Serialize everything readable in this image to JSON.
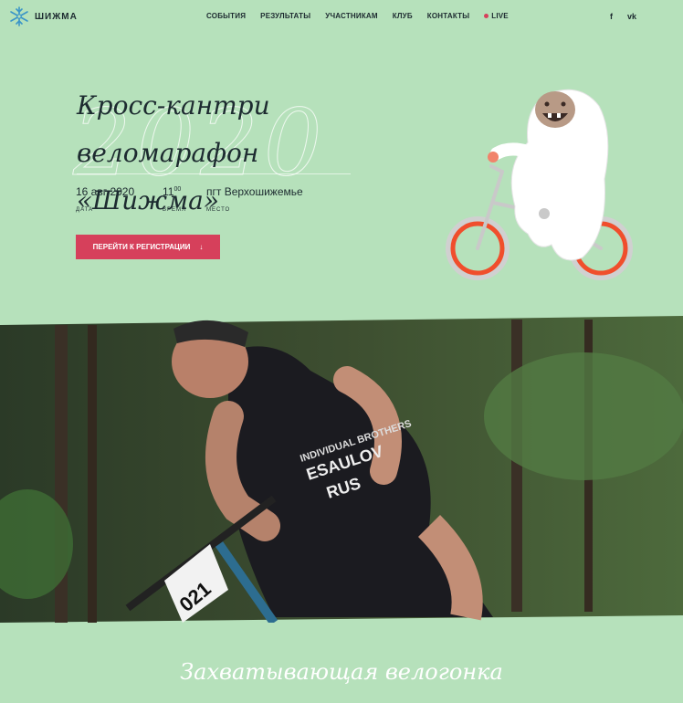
{
  "nav": {
    "logo_text": "ШИЖМА",
    "items": [
      "СОБЫТИЯ",
      "РЕЗУЛЬТАТЫ",
      "УЧАСТНИКАМ",
      "КЛУБ",
      "КОНТАКТЫ"
    ],
    "live_label": "LIVE",
    "social": {
      "facebook": "f",
      "vk": "vk"
    }
  },
  "hero": {
    "title_line1": "Кросс-кантри веломарафон",
    "title_line2": "«Шижма»",
    "year": "2020",
    "date_value": "16 авг 2020",
    "date_label": "ДАТА",
    "time_hour": "11",
    "time_minutes": "00",
    "time_label": "ВРЕМЯ",
    "place_value": "пгт Верхошижемье",
    "place_label": "МЕСТО",
    "register_button": "ПЕРЕЙТИ К РЕГИСТРАЦИИ",
    "register_arrow": "↓"
  },
  "photo": {
    "bib_number": "021",
    "jersey_text": [
      "INDIVIDUAL BROTHERS",
      "ESAULOV",
      "RUS"
    ]
  },
  "section": {
    "subtitle": "Захватывающая велогонка"
  },
  "colors": {
    "background": "#b6e1bb",
    "accent": "#d6405b",
    "text": "#1d2b30",
    "wheel": "#f04e2c"
  }
}
